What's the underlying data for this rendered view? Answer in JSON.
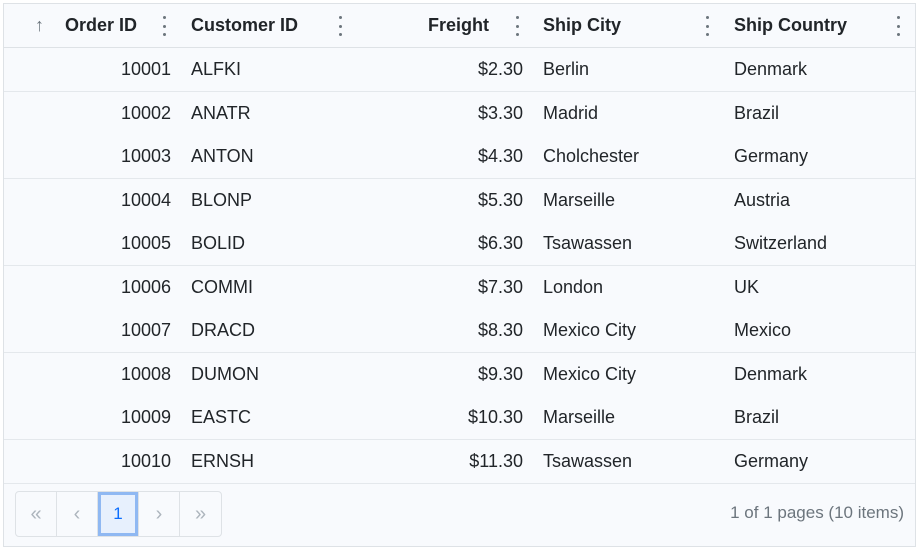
{
  "columns": {
    "order_id": "Order ID",
    "customer_id": "Customer ID",
    "freight": "Freight",
    "ship_city": "Ship City",
    "ship_country": "Ship Country"
  },
  "sort_icon": "arrow-up-icon",
  "rows": [
    {
      "order_id": "10001",
      "customer_id": "ALFKI",
      "freight": "$2.30",
      "ship_city": "Berlin",
      "ship_country": "Denmark"
    },
    {
      "order_id": "10002",
      "customer_id": "ANATR",
      "freight": "$3.30",
      "ship_city": "Madrid",
      "ship_country": "Brazil"
    },
    {
      "order_id": "10003",
      "customer_id": "ANTON",
      "freight": "$4.30",
      "ship_city": "Cholchester",
      "ship_country": "Germany"
    },
    {
      "order_id": "10004",
      "customer_id": "BLONP",
      "freight": "$5.30",
      "ship_city": "Marseille",
      "ship_country": "Austria"
    },
    {
      "order_id": "10005",
      "customer_id": "BOLID",
      "freight": "$6.30",
      "ship_city": "Tsawassen",
      "ship_country": "Switzerland"
    },
    {
      "order_id": "10006",
      "customer_id": "COMMI",
      "freight": "$7.30",
      "ship_city": "London",
      "ship_country": "UK"
    },
    {
      "order_id": "10007",
      "customer_id": "DRACD",
      "freight": "$8.30",
      "ship_city": "Mexico City",
      "ship_country": "Mexico"
    },
    {
      "order_id": "10008",
      "customer_id": "DUMON",
      "freight": "$9.30",
      "ship_city": "Mexico City",
      "ship_country": "Denmark"
    },
    {
      "order_id": "10009",
      "customer_id": "EASTC",
      "freight": "$10.30",
      "ship_city": "Marseille",
      "ship_country": "Brazil"
    },
    {
      "order_id": "10010",
      "customer_id": "ERNSH",
      "freight": "$11.30",
      "ship_city": "Tsawassen",
      "ship_country": "Germany"
    }
  ],
  "pager": {
    "first": "«",
    "prev": "‹",
    "current_page": "1",
    "next": "›",
    "last": "»",
    "info": "1 of 1 pages (10 items)"
  },
  "colors": {
    "accent": "#0d6efd",
    "background": "#f8fafd",
    "border": "#dee2e6"
  }
}
